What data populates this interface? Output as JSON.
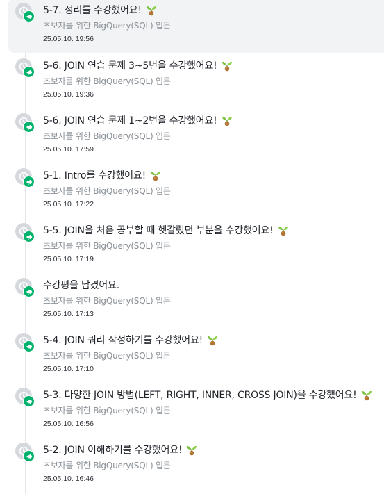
{
  "activities": [
    {
      "title": "5-7. 정리를 수강했어요!",
      "course": "초보자를 위한 BigQuery(SQL) 입문",
      "date": "25.05.10. 19:56",
      "active": true,
      "badge": true
    },
    {
      "title": "5-6. JOIN 연습 문제 3~5번을 수강했어요!",
      "course": "초보자를 위한 BigQuery(SQL) 입문",
      "date": "25.05.10. 19:36",
      "active": false,
      "badge": true
    },
    {
      "title": "5-6. JOIN 연습 문제 1~2번을 수강했어요!",
      "course": "초보자를 위한 BigQuery(SQL) 입문",
      "date": "25.05.10. 17:59",
      "active": false,
      "badge": true
    },
    {
      "title": "5-1. Intro를 수강했어요!",
      "course": "초보자를 위한 BigQuery(SQL) 입문",
      "date": "25.05.10. 17:22",
      "active": false,
      "badge": true
    },
    {
      "title": "5-5. JOIN을 처음 공부할 때 헷갈렸던 부분을 수강했어요!",
      "course": "초보자를 위한 BigQuery(SQL) 입문",
      "date": "25.05.10. 17:19",
      "active": false,
      "badge": true
    },
    {
      "title": "수강평을 남겼어요.",
      "course": "초보자를 위한 BigQuery(SQL) 입문",
      "date": "25.05.10. 17:13",
      "active": false,
      "badge": false
    },
    {
      "title": "5-4. JOIN 쿼리 작성하기를 수강했어요!",
      "course": "초보자를 위한 BigQuery(SQL) 입문",
      "date": "25.05.10. 17:10",
      "active": false,
      "badge": true
    },
    {
      "title": "5-3. 다양한 JOIN 방법(LEFT, RIGHT, INNER, CROSS JOIN)을 수강했어요!",
      "course": "초보자를 위한 BigQuery(SQL) 입문",
      "date": "25.05.10. 16:56",
      "active": false,
      "badge": true
    },
    {
      "title": "5-2. JOIN 이해하기를 수강했어요!",
      "course": "초보자를 위한 BigQuery(SQL) 입문",
      "date": "25.05.10. 16:46",
      "active": false,
      "badge": true
    }
  ],
  "icons": {
    "status": "clock-icon",
    "type": "megaphone-icon",
    "badge": "sprout-icon"
  },
  "colors": {
    "badge_green": "#00b26b",
    "clock_gray": "#d5d8dc",
    "active_bg": "#f2f3f5"
  }
}
